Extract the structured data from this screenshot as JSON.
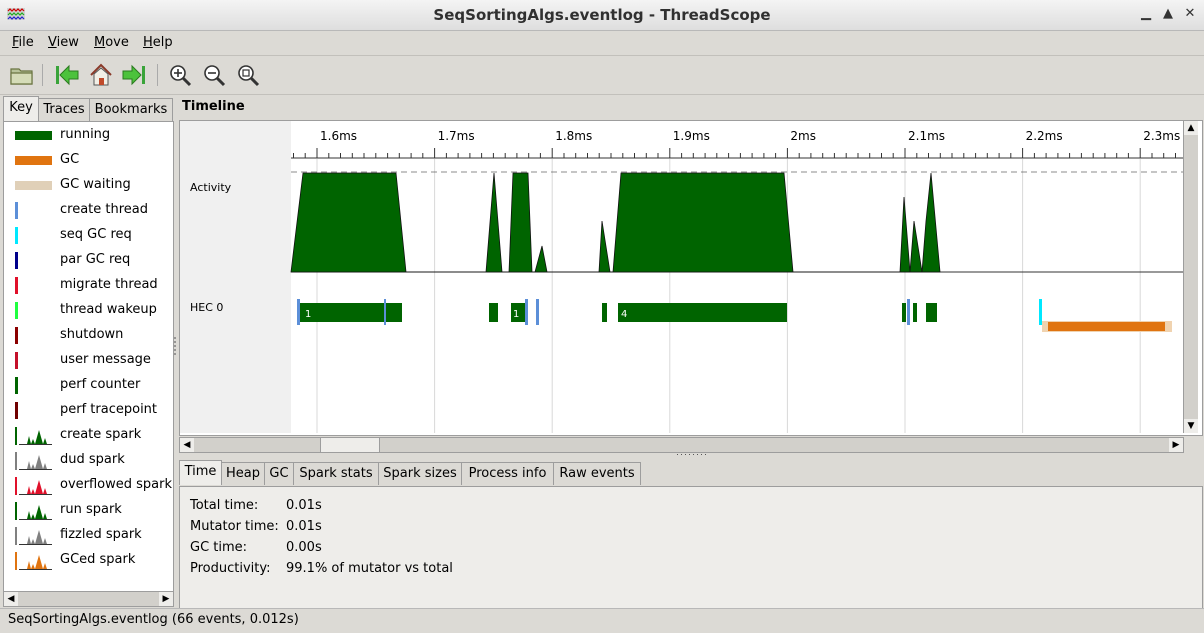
{
  "window": {
    "title": "SeqSortingAlgs.eventlog - ThreadScope"
  },
  "menu": [
    {
      "label": "File",
      "mnemonic": "F",
      "rest": "ile"
    },
    {
      "label": "View",
      "mnemonic": "V",
      "rest": "iew"
    },
    {
      "label": "Move",
      "mnemonic": "M",
      "rest": "ove"
    },
    {
      "label": "Help",
      "mnemonic": "H",
      "rest": "elp"
    }
  ],
  "toolbar": {
    "icons": [
      "open-folder-icon",
      "go-first-icon",
      "home-icon",
      "go-last-icon",
      "zoom-in-icon",
      "zoom-out-icon",
      "zoom-fit-icon"
    ]
  },
  "left_tabs": {
    "key": "Key",
    "traces": "Traces",
    "bookmarks": "Bookmarks"
  },
  "key_items": [
    {
      "label": "running",
      "kind": "swatch",
      "color": "#006400"
    },
    {
      "label": "GC",
      "kind": "swatch",
      "color": "#e07410"
    },
    {
      "label": "GC waiting",
      "kind": "swatch",
      "color": "#e0d0b8"
    },
    {
      "label": "create thread",
      "kind": "bar",
      "color": "#5c8fd8"
    },
    {
      "label": "seq GC req",
      "kind": "bar",
      "color": "#00e8ff"
    },
    {
      "label": "par GC req",
      "kind": "bar",
      "color": "#00008b"
    },
    {
      "label": "migrate thread",
      "kind": "bar",
      "color": "#e0102a"
    },
    {
      "label": "thread wakeup",
      "kind": "bar",
      "color": "#20ff40"
    },
    {
      "label": "shutdown",
      "kind": "bar",
      "color": "#8b0000"
    },
    {
      "label": "user message",
      "kind": "bar",
      "color": "#c4102a"
    },
    {
      "label": "perf counter",
      "kind": "bar",
      "color": "#006400"
    },
    {
      "label": "perf tracepoint",
      "kind": "bar",
      "color": "#700000"
    },
    {
      "label": "create spark",
      "kind": "spark",
      "color": "#006400"
    },
    {
      "label": "dud spark",
      "kind": "spark",
      "color": "#808080"
    },
    {
      "label": "overflowed spark",
      "kind": "spark",
      "color": "#e0102a"
    },
    {
      "label": "run spark",
      "kind": "spark",
      "color": "#006400"
    },
    {
      "label": "fizzled spark",
      "kind": "spark",
      "color": "#808080"
    },
    {
      "label": "GCed spark",
      "kind": "spark",
      "color": "#e07410"
    }
  ],
  "timeline": {
    "heading": "Timeline",
    "ticks": [
      "1.6ms",
      "1.7ms",
      "1.8ms",
      "1.9ms",
      "2ms",
      "2.1ms",
      "2.2ms",
      "2.3ms"
    ],
    "rows": {
      "activity": "Activity",
      "hec": "HEC 0"
    },
    "thread_labels": [
      "1",
      "1",
      "4"
    ],
    "colors": {
      "running": "#006400",
      "gc": "#e07410",
      "gc_waiting": "#f0c090",
      "create_thread": "#5c8fd8",
      "seq_gc_req": "#00e8ff"
    }
  },
  "bottom_tabs": [
    "Time",
    "Heap",
    "GC",
    "Spark stats",
    "Spark sizes",
    "Process info",
    "Raw events"
  ],
  "info": {
    "total_time_label": "Total time:",
    "total_time_value": "0.01s",
    "mutator_time_label": "Mutator time:",
    "mutator_time_value": "0.01s",
    "gc_time_label": "GC time:",
    "gc_time_value": "0.00s",
    "productivity_label": "Productivity:",
    "productivity_value": "99.1% of mutator vs total"
  },
  "status": {
    "text": "SeqSortingAlgs.eventlog (66 events, 0.012s)"
  }
}
